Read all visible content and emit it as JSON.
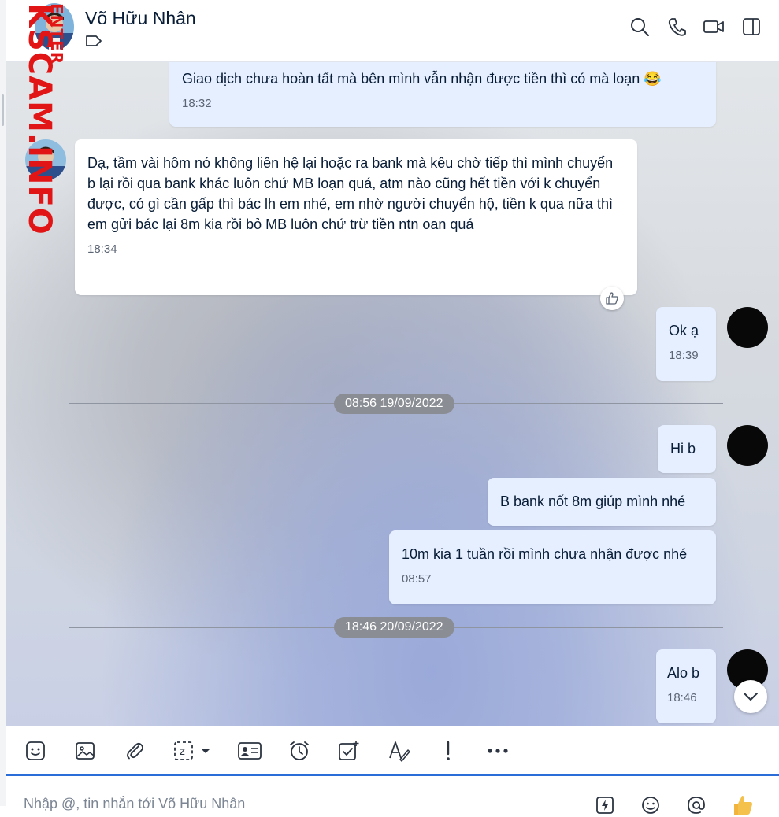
{
  "watermark": {
    "main": "KSCAM.INFO",
    "small": "ENTER"
  },
  "header": {
    "contact_name": "Võ Hữu Nhân"
  },
  "messages": [
    {
      "text": "Giao dịch chưa hoàn tất mà bên mình vẫn nhận được tiền thì có mà loạn 😂",
      "time": "18:32"
    },
    {
      "text": "Dạ, tầm vài hôm nó không liên hệ lại hoặc ra bank mà kêu chờ tiếp thì mình chuyển b lại rồi qua bank khác luôn chứ MB loạn quá, atm nào cũng hết tiền với k chuyển được, có gì cần gấp thì bác lh em nhé, em nhờ người chuyển hộ, tiền k qua nữa thì em gửi bác lại 8m kia rồi bỏ MB luôn chứ trừ tiền ntn oan quá",
      "time": "18:34"
    },
    {
      "text": "Ok ạ",
      "time": "18:39"
    },
    {
      "text": "Hi b"
    },
    {
      "text": "B bank nốt 8m giúp mình nhé"
    },
    {
      "text": "10m kia 1 tuần rồi mình chưa nhận được nhé",
      "time": "08:57"
    },
    {
      "text": "Alo b",
      "time": "18:46"
    }
  ],
  "dividers": [
    "08:56 19/09/2022",
    "18:46 20/09/2022"
  ],
  "composer": {
    "placeholder": "Nhập @, tin nhắn tới Võ Hữu Nhân"
  }
}
